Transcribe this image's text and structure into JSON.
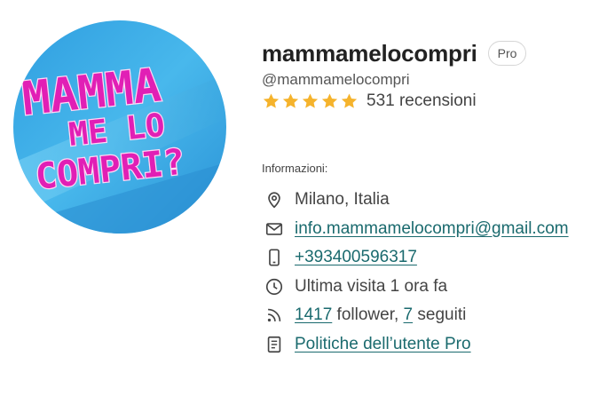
{
  "profile": {
    "avatar_text": [
      "MAMMA",
      "ME LO",
      "COMPRI?"
    ],
    "username": "mammamelocompri",
    "badge": "Pro",
    "handle": "@mammamelocompri",
    "rating": 5,
    "reviews_count_label": "531 recensioni"
  },
  "info": {
    "title": "Informazioni:",
    "location": "Milano, Italia",
    "email": "info.mammamelocompri@gmail.com",
    "phone": "+393400596317",
    "last_visit": "Ultima visita 1 ora fa",
    "followers_count": "1417",
    "followers_label": " follower, ",
    "following_count": "7",
    "following_label": " seguiti",
    "policy": "Politiche dell’utente Pro"
  },
  "colors": {
    "star": "#f5b32c",
    "link": "#1a6a6e",
    "avatar_bg": "#37a8e4",
    "avatar_text": "#e11fb5"
  },
  "icons": [
    "location-pin-icon",
    "mail-icon",
    "phone-icon",
    "clock-icon",
    "rss-icon",
    "document-icon"
  ]
}
